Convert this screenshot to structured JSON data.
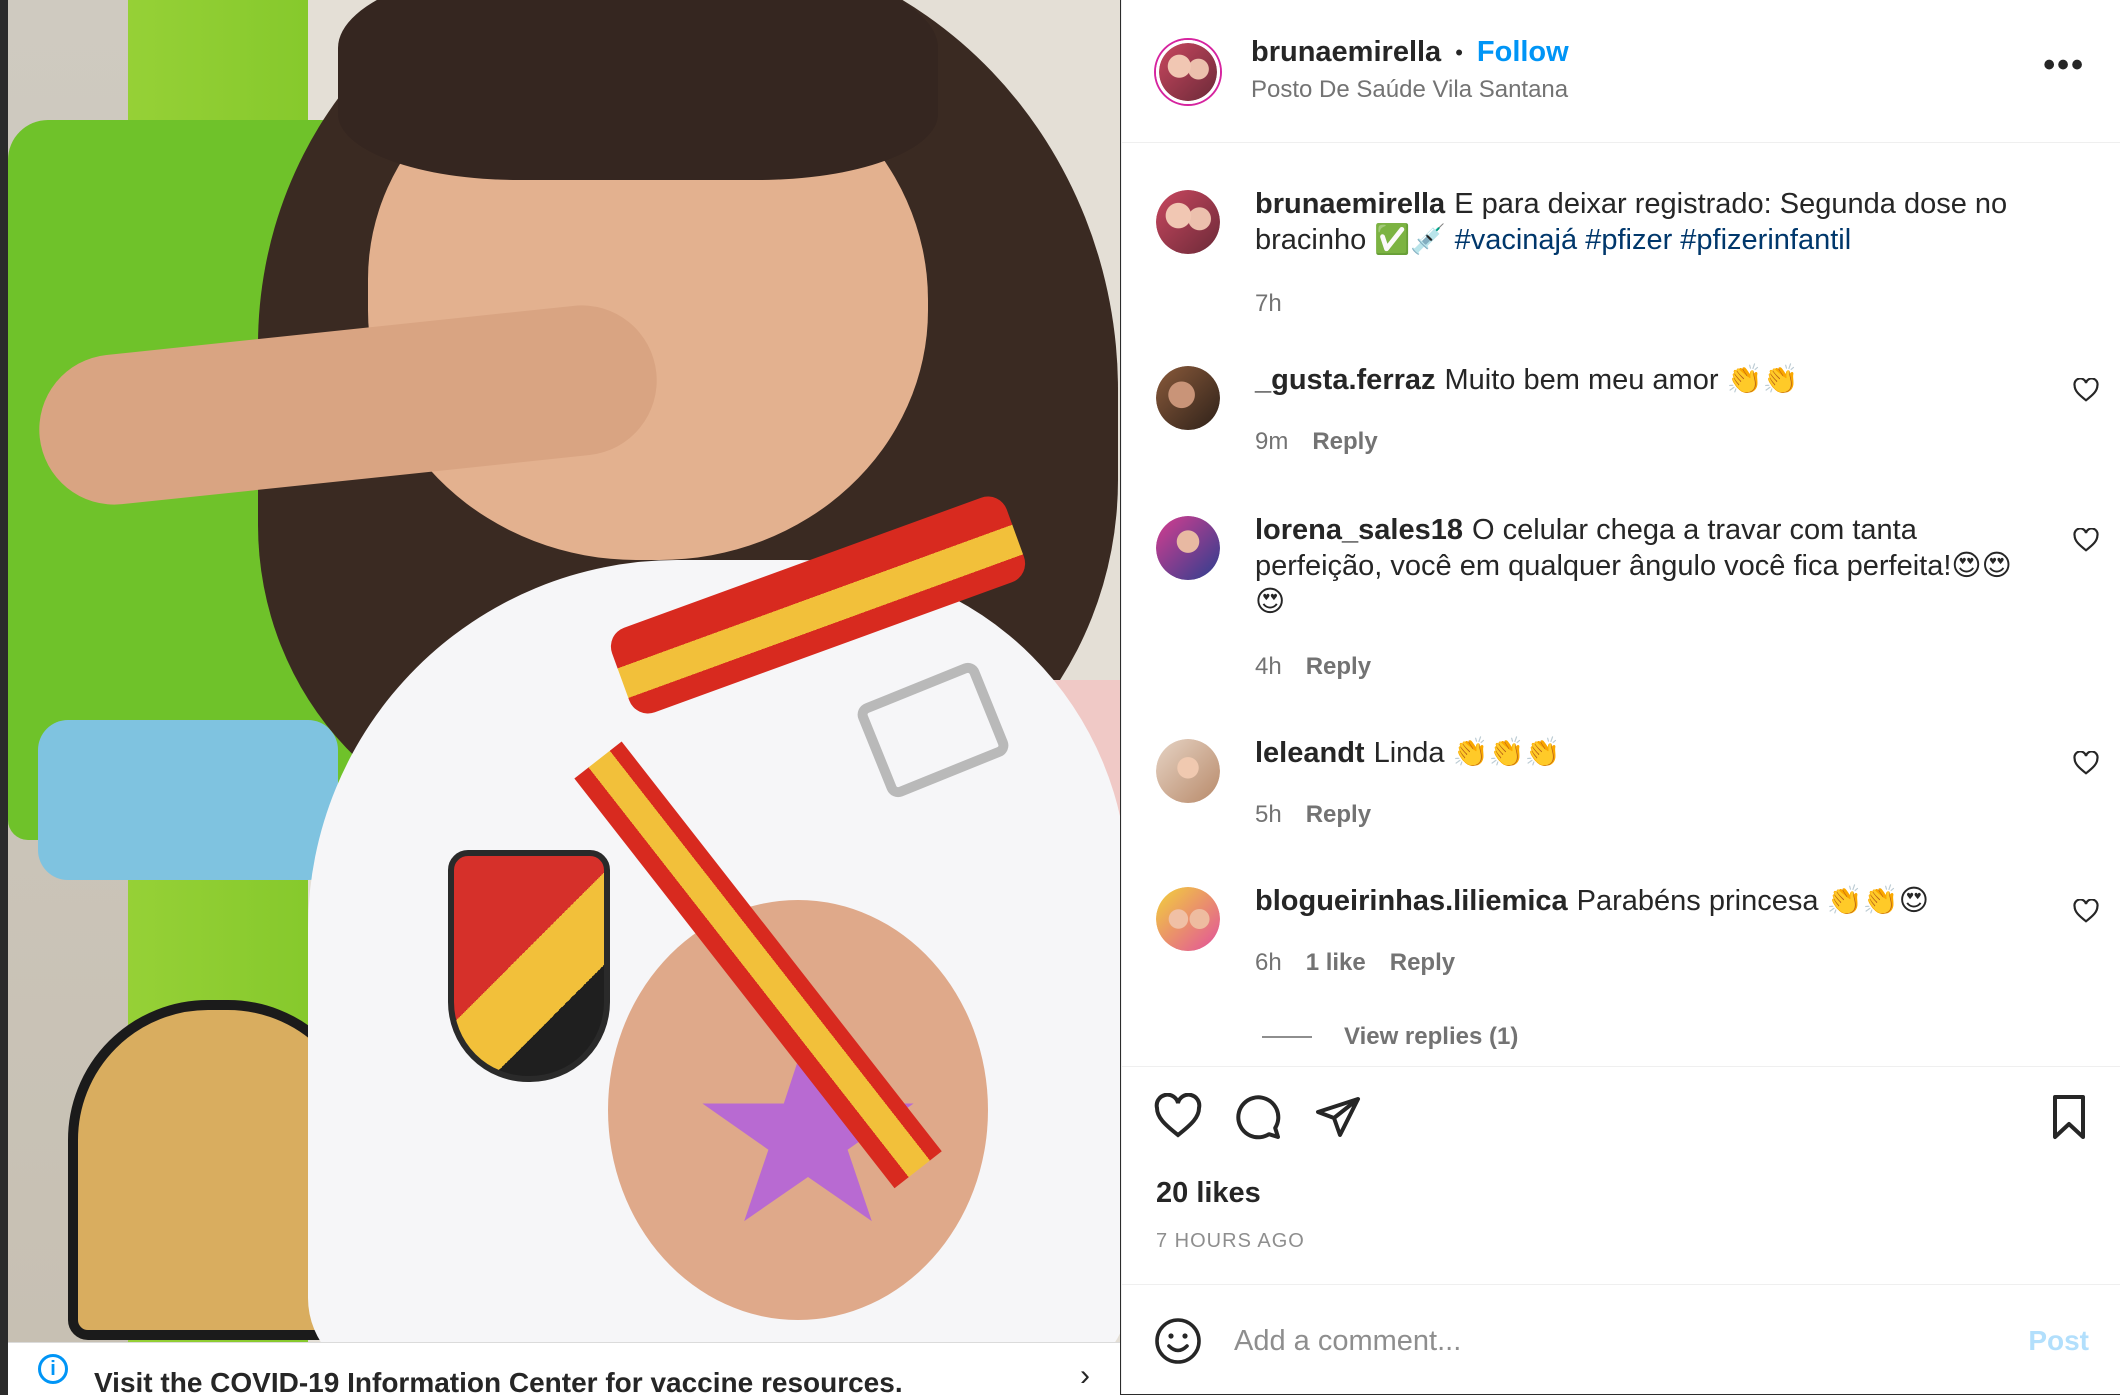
{
  "post": {
    "username": "brunaemirella",
    "follow_label": "Follow",
    "location": "Posto De Saúde Vila Santana",
    "dot": "•",
    "more": "•••"
  },
  "caption": {
    "username": "brunaemirella",
    "text": "E para deixar registrado: Segunda dose no bracinho ✅💉",
    "hashtags": [
      "#vacinajá",
      "#pfizer",
      "#pfizerinfantil"
    ],
    "time": "7h"
  },
  "comments": [
    {
      "username": "_gusta.ferraz",
      "text": "Muito bem meu amor 👏👏",
      "time": "9m",
      "likes": "",
      "reply": "Reply"
    },
    {
      "username": "lorena_sales18",
      "text": "O celular chega a travar com tanta perfeição, você em qualquer ângulo você fica perfeita!😍😍😍",
      "time": "4h",
      "likes": "",
      "reply": "Reply"
    },
    {
      "username": "leleandt",
      "text": "Linda 👏👏👏",
      "time": "5h",
      "likes": "",
      "reply": "Reply"
    },
    {
      "username": "blogueirinhas.liliemica",
      "text": "Parabéns princesa 👏👏😍",
      "time": "6h",
      "likes": "1 like",
      "reply": "Reply"
    }
  ],
  "view_replies": "View replies (1)",
  "actions": {
    "likes_count": "20 likes",
    "time_ago": "7 HOURS AGO"
  },
  "add_comment": {
    "placeholder": "Add a comment...",
    "post_label": "Post"
  },
  "banner": {
    "text": "Visit the COVID-19 Information Center for vaccine resources.",
    "info": "i",
    "chevron": "›"
  },
  "colors": {
    "accent": "#0095f6",
    "hashtag": "#00376b",
    "muted": "#737373",
    "post_disabled": "#b2dffc"
  }
}
